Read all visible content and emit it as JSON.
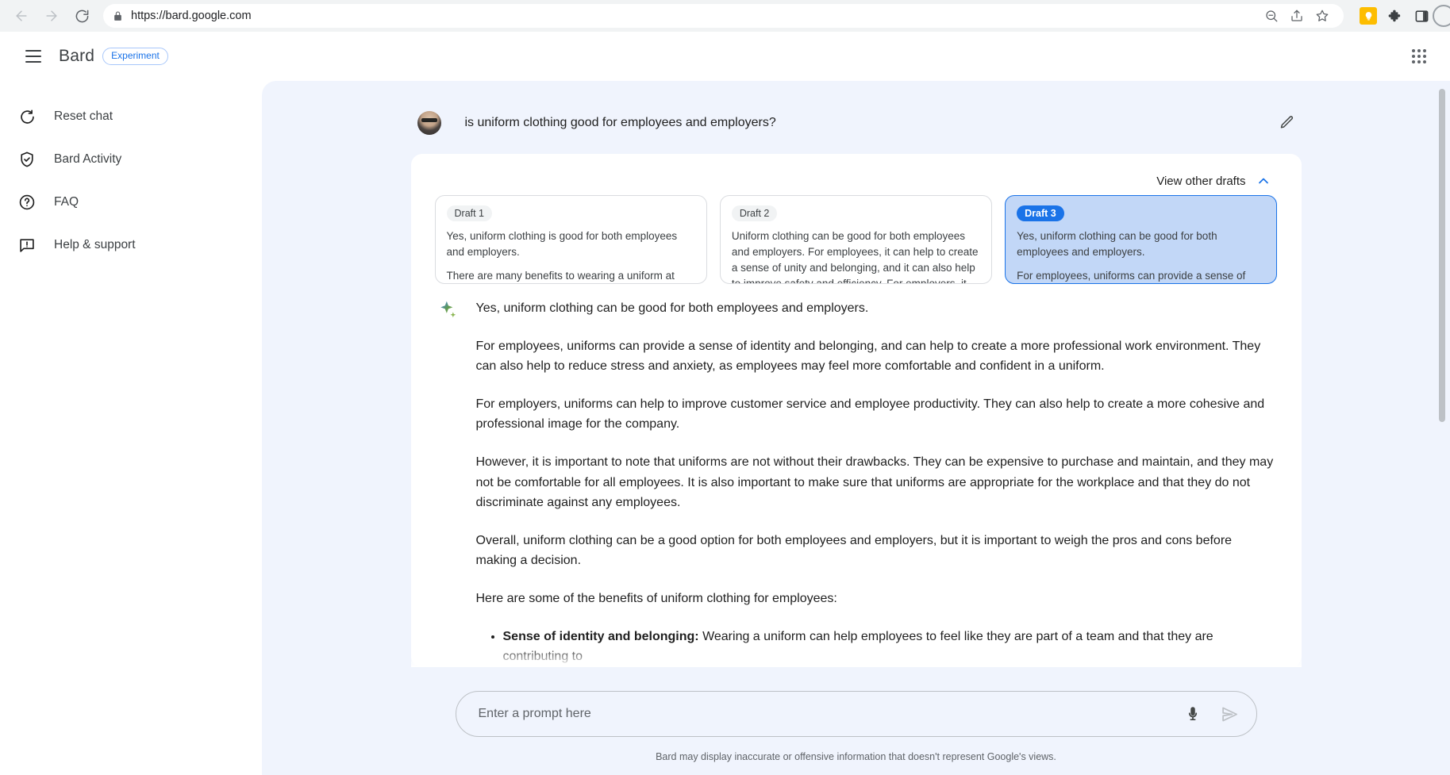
{
  "browser": {
    "back_icon": "back-arrow-icon",
    "forward_icon": "forward-arrow-icon",
    "reload_icon": "reload-icon",
    "lock_icon": "lock-icon",
    "url": "https://bard.google.com",
    "zoom_out_icon": "zoom-out-icon",
    "share_icon": "share-icon",
    "bookmark_icon": "star-icon",
    "extension_yellow_icon": "lightbulb-extension-icon",
    "extensions_icon": "puzzle-piece-icon",
    "sidepanel_icon": "side-panel-icon",
    "profile_icon": "profile-avatar-icon"
  },
  "header": {
    "menu_icon": "hamburger-menu-icon",
    "brand": "Bard",
    "badge": "Experiment",
    "apps_icon": "google-apps-grid-icon"
  },
  "sidebar": {
    "items": [
      {
        "label": "Reset chat",
        "icon": "reset-icon"
      },
      {
        "label": "Bard Activity",
        "icon": "shield-check-icon"
      },
      {
        "label": "FAQ",
        "icon": "question-circle-icon"
      },
      {
        "label": "Help & support",
        "icon": "feedback-icon"
      }
    ]
  },
  "conversation": {
    "user_avatar": "user-avatar",
    "prompt": "is uniform clothing good for employees and employers?",
    "edit_icon": "edit-pencil-icon",
    "drafts_label": "View other drafts",
    "drafts_chevron": "chevron-up-icon",
    "drafts": [
      {
        "badge": "Draft 1",
        "selected": false,
        "paragraphs": [
          "Yes, uniform clothing is good for both employees and employers.",
          "There are many benefits to wearing a uniform at work. Employees who wear uniforms feel more professional and"
        ]
      },
      {
        "badge": "Draft 2",
        "selected": false,
        "paragraphs": [
          "Uniform clothing can be good for both employees and employers. For employees, it can help to create a sense of unity and belonging, and it can also help to improve safety and efficiency. For employers, it can help to create a professional image, and it can also help to reduce costs."
        ]
      },
      {
        "badge": "Draft 3",
        "selected": true,
        "paragraphs": [
          "Yes, uniform clothing can be good for both employees and employers.",
          "For employees, uniforms can provide a sense of identity and belonging, and can help to create a more professional work"
        ]
      }
    ],
    "bard_icon": "bard-sparkle-icon",
    "response_paragraphs": [
      "Yes, uniform clothing can be good for both employees and employers.",
      "For employees, uniforms can provide a sense of identity and belonging, and can help to create a more professional work environment. They can also help to reduce stress and anxiety, as employees may feel more comfortable and confident in a uniform.",
      "For employers, uniforms can help to improve customer service and employee productivity. They can also help to create a more cohesive and professional image for the company.",
      "However, it is important to note that uniforms are not without their drawbacks. They can be expensive to purchase and maintain, and they may not be comfortable for all employees. It is also important to make sure that uniforms are appropriate for the workplace and that they do not discriminate against any employees.",
      "Overall, uniform clothing can be a good option for both employees and employers, but it is important to weigh the pros and cons before making a decision.",
      "Here are some of the benefits of uniform clothing for employees:"
    ],
    "benefit_item_bold": "Sense of identity and belonging:",
    "benefit_item_rest": " Wearing a uniform can help employees to feel like they are part of a team and that they are contributing to"
  },
  "composer": {
    "placeholder": "Enter a prompt here",
    "value": "",
    "mic_icon": "microphone-icon",
    "send_icon": "send-icon",
    "disclaimer": "Bard may display inaccurate or offensive information that doesn't represent Google's views."
  },
  "colors": {
    "accent_blue": "#1a73e8",
    "panel_bg": "#f0f4fd",
    "selected_draft_bg": "#c2d7f7",
    "extension_yellow": "#fdbd00"
  }
}
